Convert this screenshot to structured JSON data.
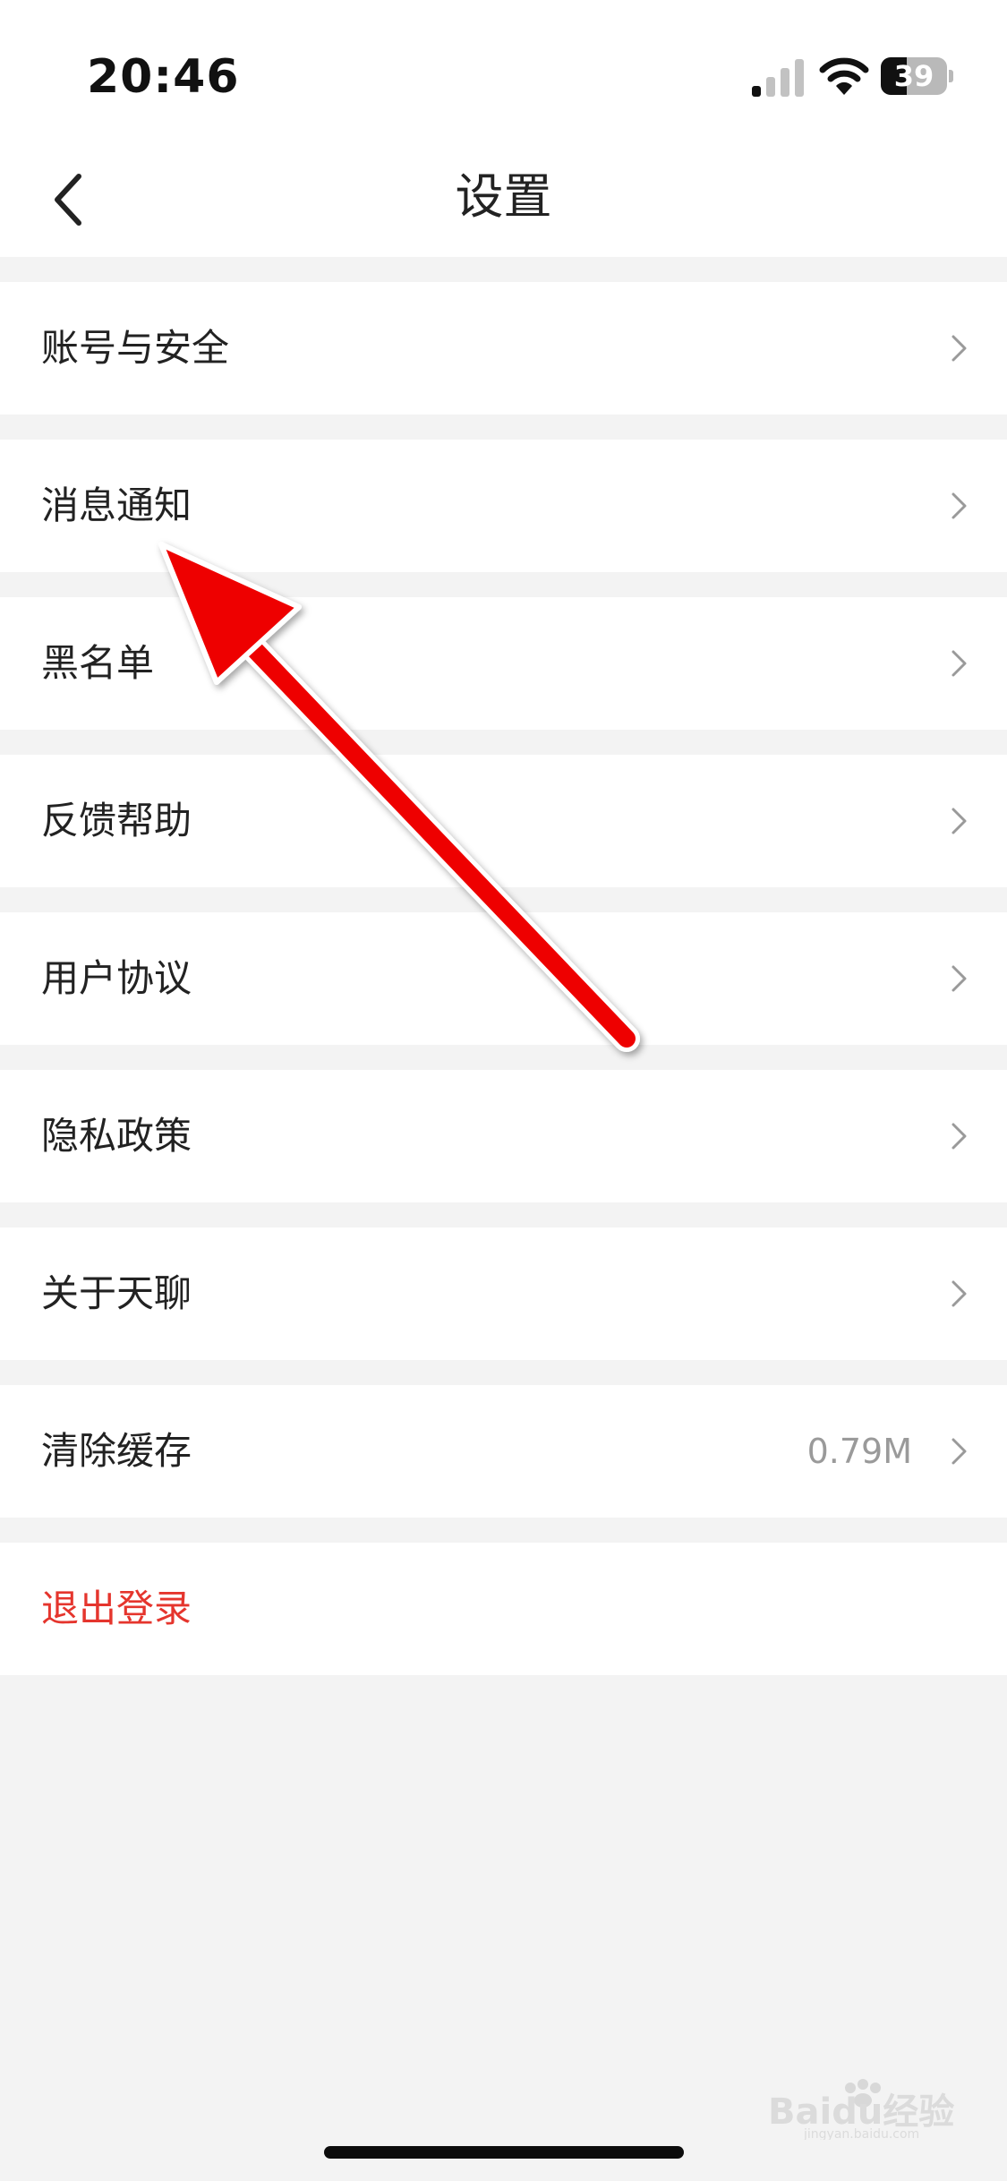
{
  "status_bar": {
    "time": "20:46",
    "battery_level": "39",
    "battery_fraction": 0.39
  },
  "nav": {
    "title": "设置",
    "back_icon": "chevron-left-icon"
  },
  "settings": {
    "items": [
      {
        "label": "账号与安全",
        "value": ""
      },
      {
        "label": "消息通知",
        "value": ""
      },
      {
        "label": "黑名单",
        "value": ""
      },
      {
        "label": "反馈帮助",
        "value": ""
      },
      {
        "label": "用户协议",
        "value": ""
      },
      {
        "label": "隐私政策",
        "value": ""
      },
      {
        "label": "关于天聊",
        "value": ""
      },
      {
        "label": "清除缓存",
        "value": "0.79M"
      }
    ],
    "logout_label": "退出登录"
  },
  "colors": {
    "danger": "#e5352d",
    "annotation_arrow": "#ee0000",
    "background": "#f3f3f3"
  },
  "watermark": {
    "text": "Baidu经验",
    "subtext": "jingyan.baidu.com"
  }
}
